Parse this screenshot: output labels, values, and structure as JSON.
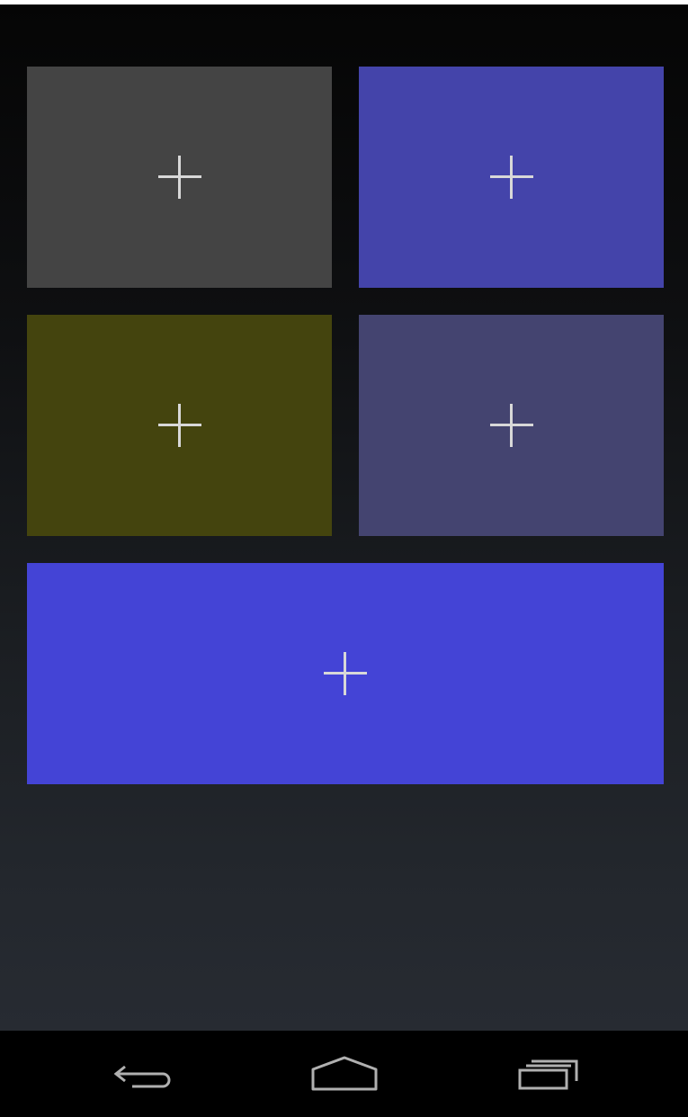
{
  "colors": {
    "tile_1": "#444444",
    "tile_2": "#4444aa",
    "tile_3": "#44440e",
    "tile_4": "#444470",
    "tile_5": "#4444d6",
    "plus_icon": "#d8d8d8",
    "nav_icon": "#b0b0b0",
    "nav_bar": "#000000"
  },
  "tiles": [
    {
      "icon": "plus-icon",
      "color": "#444444"
    },
    {
      "icon": "plus-icon",
      "color": "#4444aa"
    },
    {
      "icon": "plus-icon",
      "color": "#44440e"
    },
    {
      "icon": "plus-icon",
      "color": "#444470"
    },
    {
      "icon": "plus-icon",
      "color": "#4444d6"
    }
  ],
  "nav": {
    "back_icon": "back-arrow-icon",
    "home_icon": "home-icon",
    "recent_icon": "recent-apps-icon"
  }
}
